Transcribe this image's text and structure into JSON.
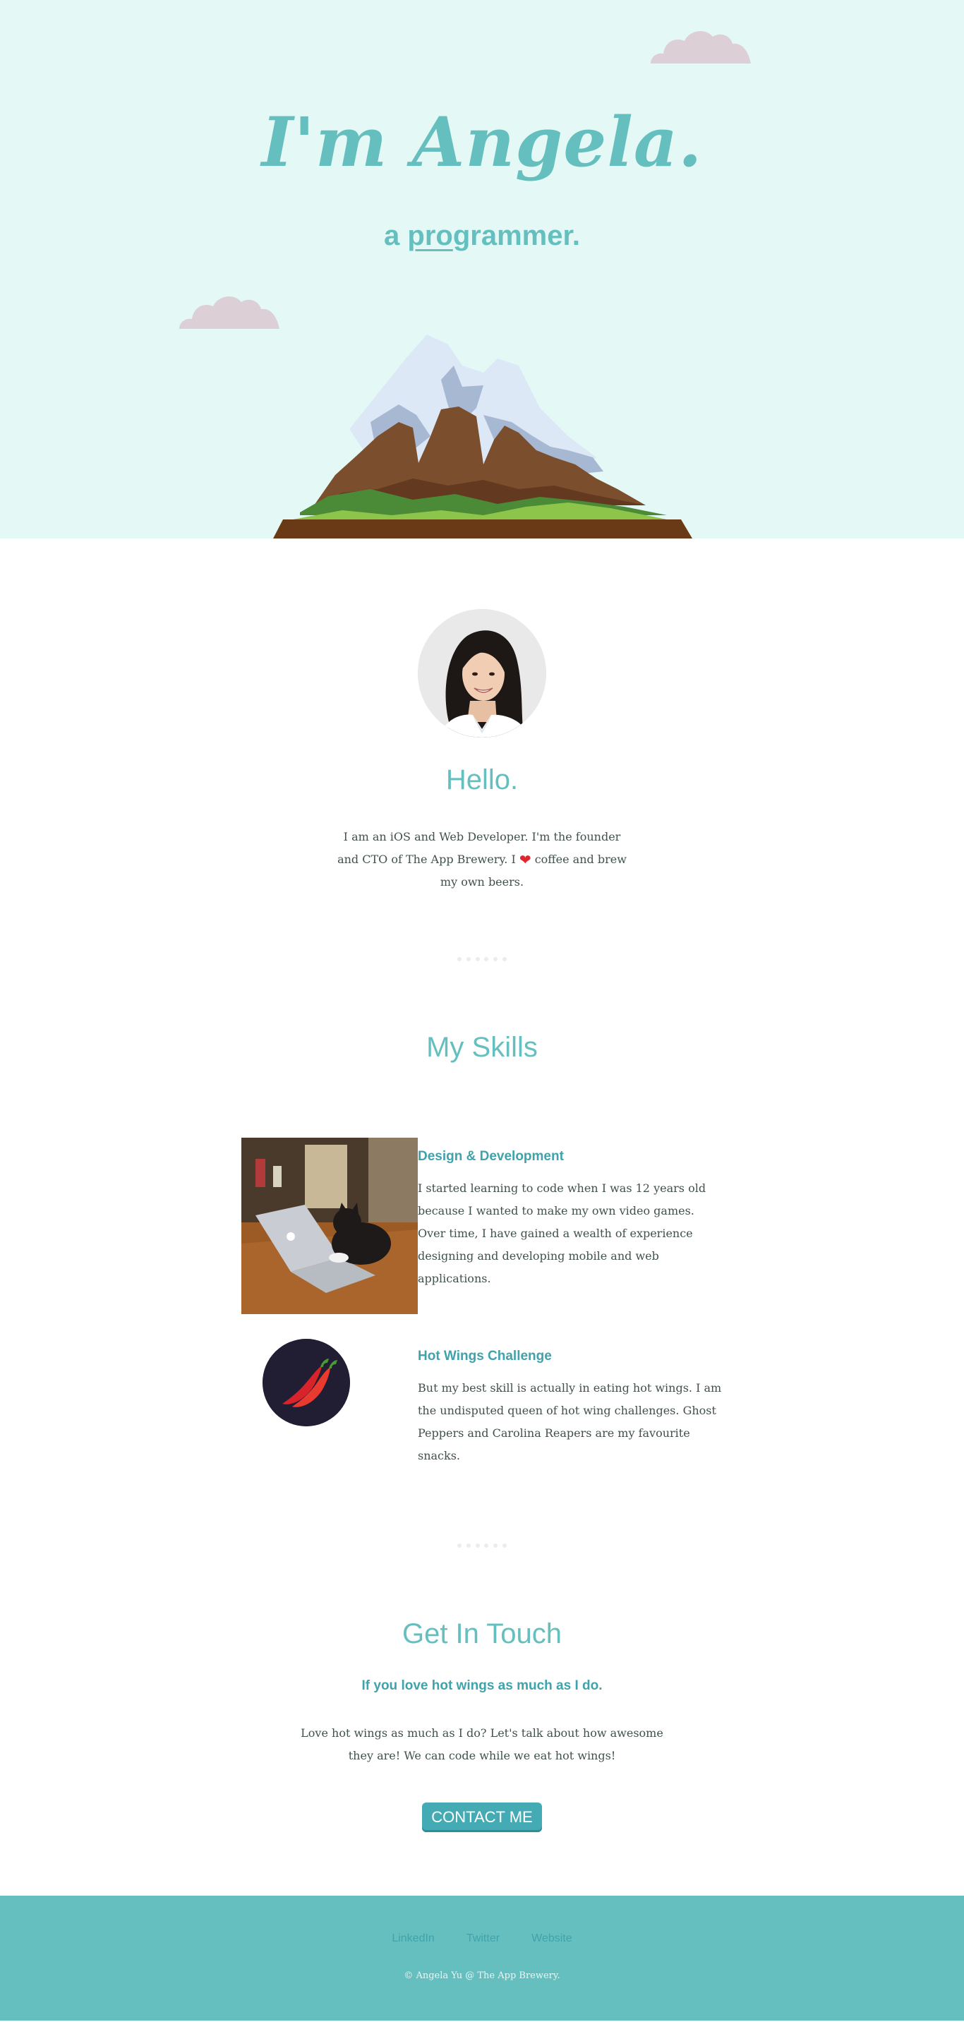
{
  "hero": {
    "title": "I'm Angela.",
    "subtitle_prefix": "a ",
    "subtitle_pro": "pro",
    "subtitle_suffix": "grammer."
  },
  "about": {
    "avatar_alt": "Angela profile photo",
    "heading": "Hello.",
    "bio_part1": "I am an iOS and Web Developer. I'm the founder and CTO of The App Brewery. I ",
    "bio_heart": "❤",
    "bio_part2": " coffee and brew my own beers."
  },
  "skills": {
    "heading": "My Skills",
    "items": [
      {
        "title": "Design & Development",
        "text": "I started learning to code when I was 12 years old because I wanted to make my own video games. Over time, I have gained a wealth of experience designing and developing mobile and web applications.",
        "icon": "cat-laptop-photo"
      },
      {
        "title": "Hot Wings Challenge",
        "text": "But my best skill is actually in eating hot wings. I am the undisputed queen of hot wing challenges. Ghost Peppers and Carolina Reapers are my favourite snacks.",
        "icon": "chilli-icon"
      }
    ]
  },
  "contact": {
    "heading": "Get In Touch",
    "subheading": "If you love hot wings as much as I do.",
    "text": "Love hot wings as much as I do? Let's talk about how awesome they are! We can code while we eat hot wings!",
    "button_label": "CONTACT ME"
  },
  "footer": {
    "links": [
      "LinkedIn",
      "Twitter",
      "Website"
    ],
    "copyright": "© Angela Yu @ The App Brewery."
  },
  "colors": {
    "hero_bg": "#e4f9f5",
    "accent": "#66BFBF",
    "heading_dark": "#40a2aa",
    "text": "#40514e",
    "cloud": "#ddd2d8"
  }
}
